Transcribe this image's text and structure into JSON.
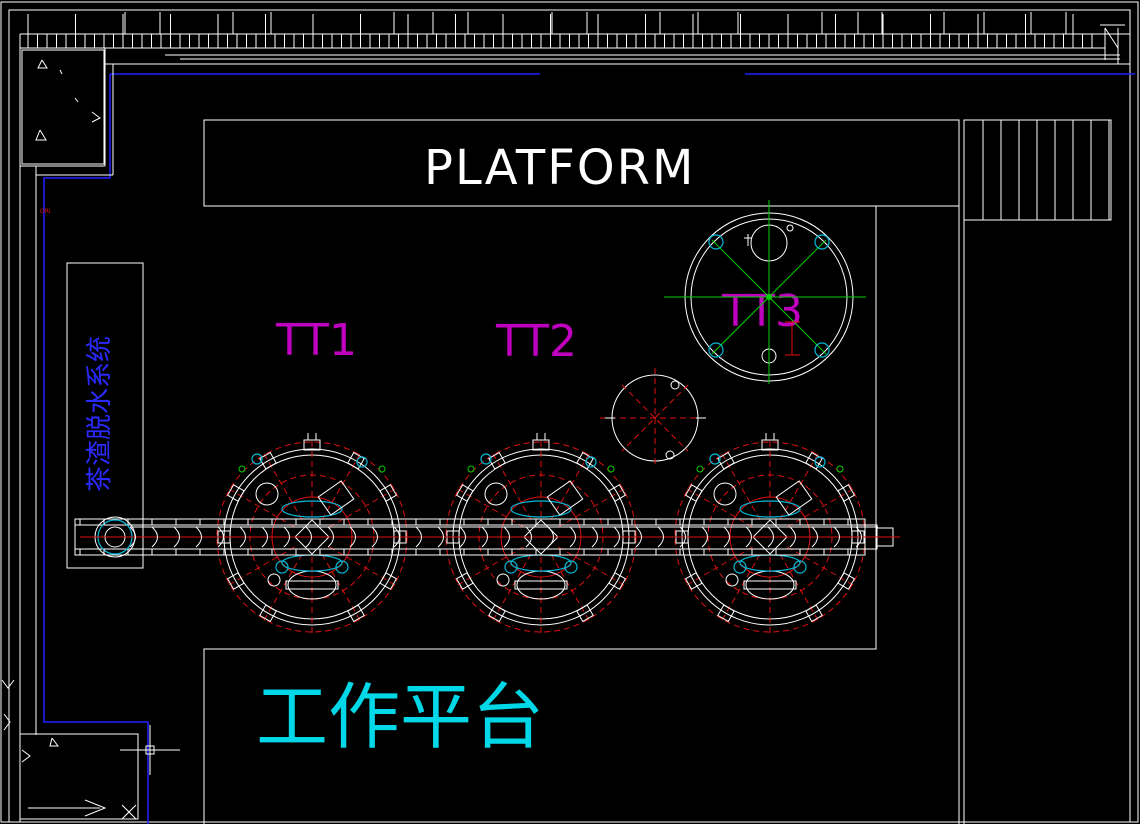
{
  "labels": {
    "platform": "PLATFORM",
    "work_platform": "工作平台",
    "dewatering_system": "茶渣脱水系统",
    "tanks": [
      "TT1",
      "TT2",
      "TT3"
    ]
  },
  "colors": {
    "background": "#000000",
    "line_white": "#ffffff",
    "tank_label": "#c000c0",
    "work_platform_label": "#00d8e8",
    "side_label": "#2a2aff",
    "red_dashed": "#e01010",
    "cyan_detail": "#00b8d8",
    "green_centerline": "#00d000",
    "blue_boundary": "#2020ff"
  }
}
